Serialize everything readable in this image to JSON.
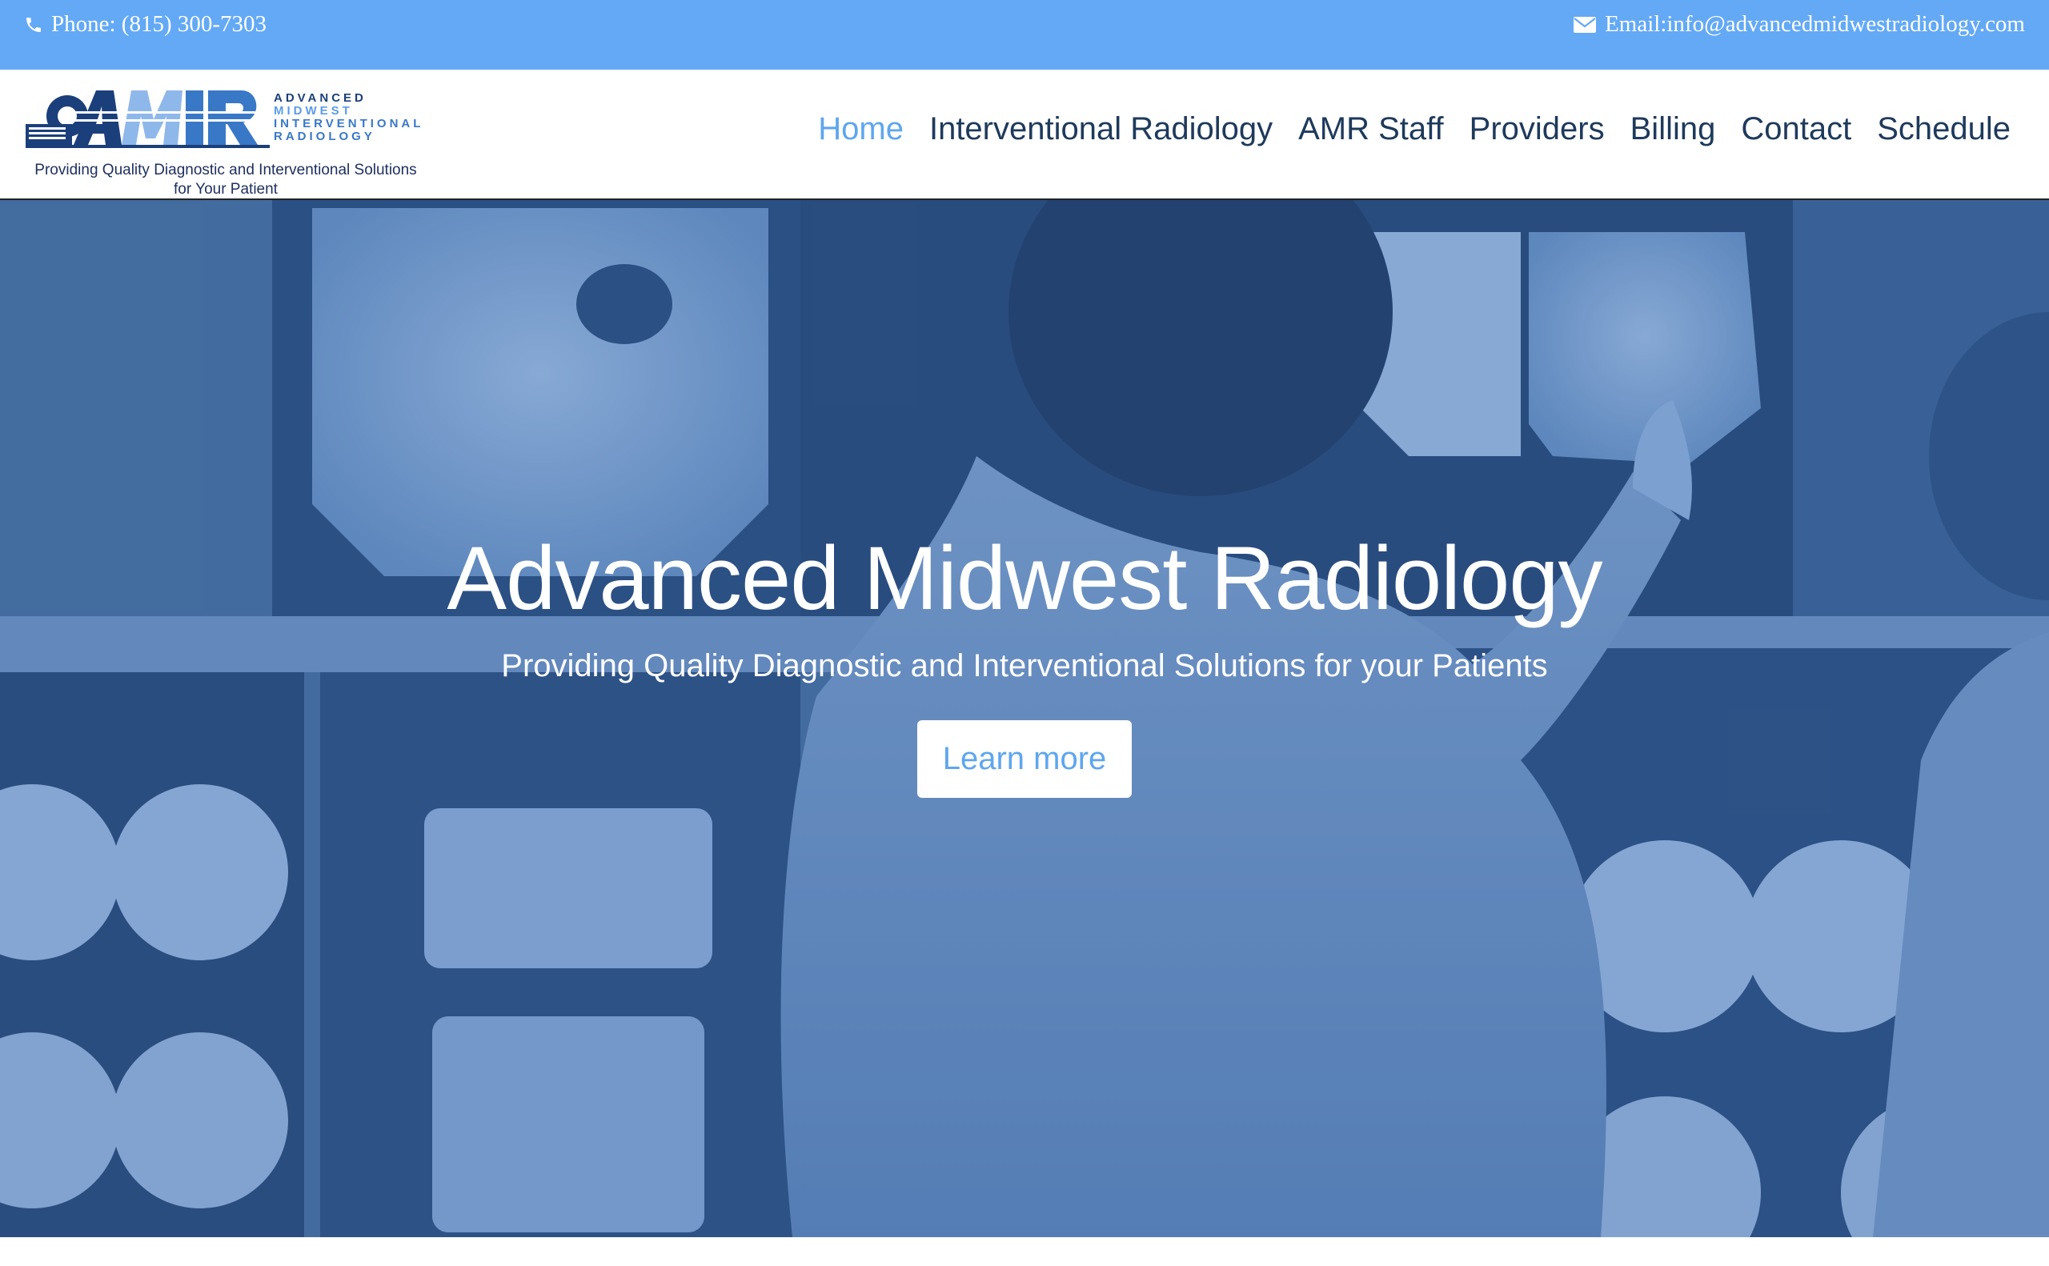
{
  "topbar": {
    "phone_text": "Phone: (815) 300-7303",
    "phone_icon": "phone-icon",
    "email_text": "Email:info@advancedmidwestradiology.com",
    "email_icon": "envelope-icon"
  },
  "logo": {
    "line1": "ADVANCED",
    "line2": "MIDWEST",
    "line3": "INTERVENTIONAL",
    "line4": "RADIOLOGY",
    "tagline_line1": "Providing Quality Diagnostic and Interventional Solutions",
    "tagline_line2": "for Your Patient"
  },
  "nav": {
    "items": [
      {
        "label": "Home",
        "active": true
      },
      {
        "label": "Interventional Radiology"
      },
      {
        "label": "AMR Staff"
      },
      {
        "label": "Providers"
      },
      {
        "label": "Billing"
      },
      {
        "label": "Contact"
      },
      {
        "label": "Schedule"
      }
    ]
  },
  "hero": {
    "title": "Advanced Midwest Radiology",
    "subtitle": "Providing Quality Diagnostic and Interventional Solutions for your Patients",
    "cta_label": "Learn more"
  },
  "colors": {
    "topbar_bg": "#63a9f5",
    "nav_text": "#1e3a5c",
    "nav_active": "#5ea6ef",
    "hero_tint": "#4f7bb0"
  }
}
